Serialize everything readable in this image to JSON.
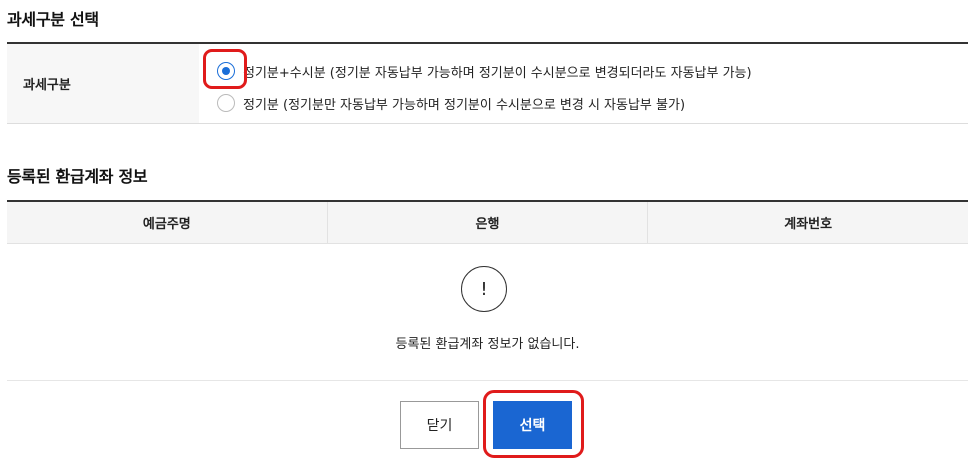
{
  "tax_section": {
    "title": "과세구분 선택",
    "label": "과세구분",
    "options": [
      {
        "label": "정기분+수시분 (정기분 자동납부 가능하며 정기분이 수시분으로 변경되더라도 자동납부 가능)",
        "checked": true
      },
      {
        "label": "정기분 (정기분만 자동납부 가능하며 정기분이 수시분으로 변경 시 자동납부 불가)",
        "checked": false
      }
    ]
  },
  "account_section": {
    "title": "등록된 환급계좌 정보",
    "columns": [
      "예금주명",
      "은행",
      "계좌번호"
    ],
    "empty_icon": "!",
    "empty_message": "등록된 환급계좌 정보가 없습니다."
  },
  "buttons": {
    "close_label": "닫기",
    "select_label": "선택"
  },
  "colors": {
    "primary": "#1a66d2",
    "highlight": "#e01b1b"
  }
}
